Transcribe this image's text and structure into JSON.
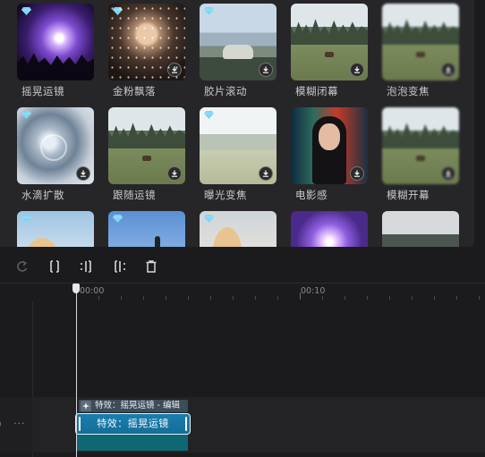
{
  "effects": {
    "tiles": [
      {
        "label": "摇晃运镜",
        "scene": "s-concert",
        "premium": true,
        "download": false
      },
      {
        "label": "金粉飘落",
        "scene": "s-girl-sparkle",
        "premium": true,
        "download": true
      },
      {
        "label": "胶片滚动",
        "scene": "s-car",
        "premium": true,
        "download": true
      },
      {
        "label": "模糊闭幕",
        "scene": "s-deer",
        "premium": false,
        "download": true
      },
      {
        "label": "泡泡变焦",
        "scene": "s-deer s-deer-blur",
        "premium": false,
        "download": true
      },
      {
        "label": "水滴扩散",
        "scene": "s-drop",
        "premium": true,
        "download": true
      },
      {
        "label": "跟随运镜",
        "scene": "s-deer",
        "premium": false,
        "download": true
      },
      {
        "label": "曝光变焦",
        "scene": "s-bright",
        "premium": true,
        "download": true
      },
      {
        "label": "电影感",
        "scene": "s-neon",
        "premium": false,
        "download": true
      },
      {
        "label": "模糊开幕",
        "scene": "s-deer s-deer-blur",
        "premium": false,
        "download": true
      },
      {
        "label": "",
        "scene": "s-blonde",
        "premium": true,
        "download": false
      },
      {
        "label": "",
        "scene": "s-sky-girl",
        "premium": true,
        "download": false
      },
      {
        "label": "",
        "scene": "s-blonde2",
        "premium": true,
        "download": false
      },
      {
        "label": "",
        "scene": "s-concert2",
        "premium": false,
        "download": false
      },
      {
        "label": "",
        "scene": "s-dark-forest",
        "premium": false,
        "download": false
      }
    ],
    "premium_color": "#7fd6f5"
  },
  "toolbar": {
    "icons": [
      "undo-icon",
      "split-icon",
      "trim-left-icon",
      "trim-right-icon",
      "delete-icon"
    ]
  },
  "timeline": {
    "ruler_labels": [
      "00:00",
      "00:10"
    ],
    "clip": {
      "tag": "特效：摇晃运镜 - 编辑",
      "label": "特效：摇晃运镜",
      "color": "#1b7dad"
    },
    "row_more": "···",
    "row_edge": ")"
  }
}
